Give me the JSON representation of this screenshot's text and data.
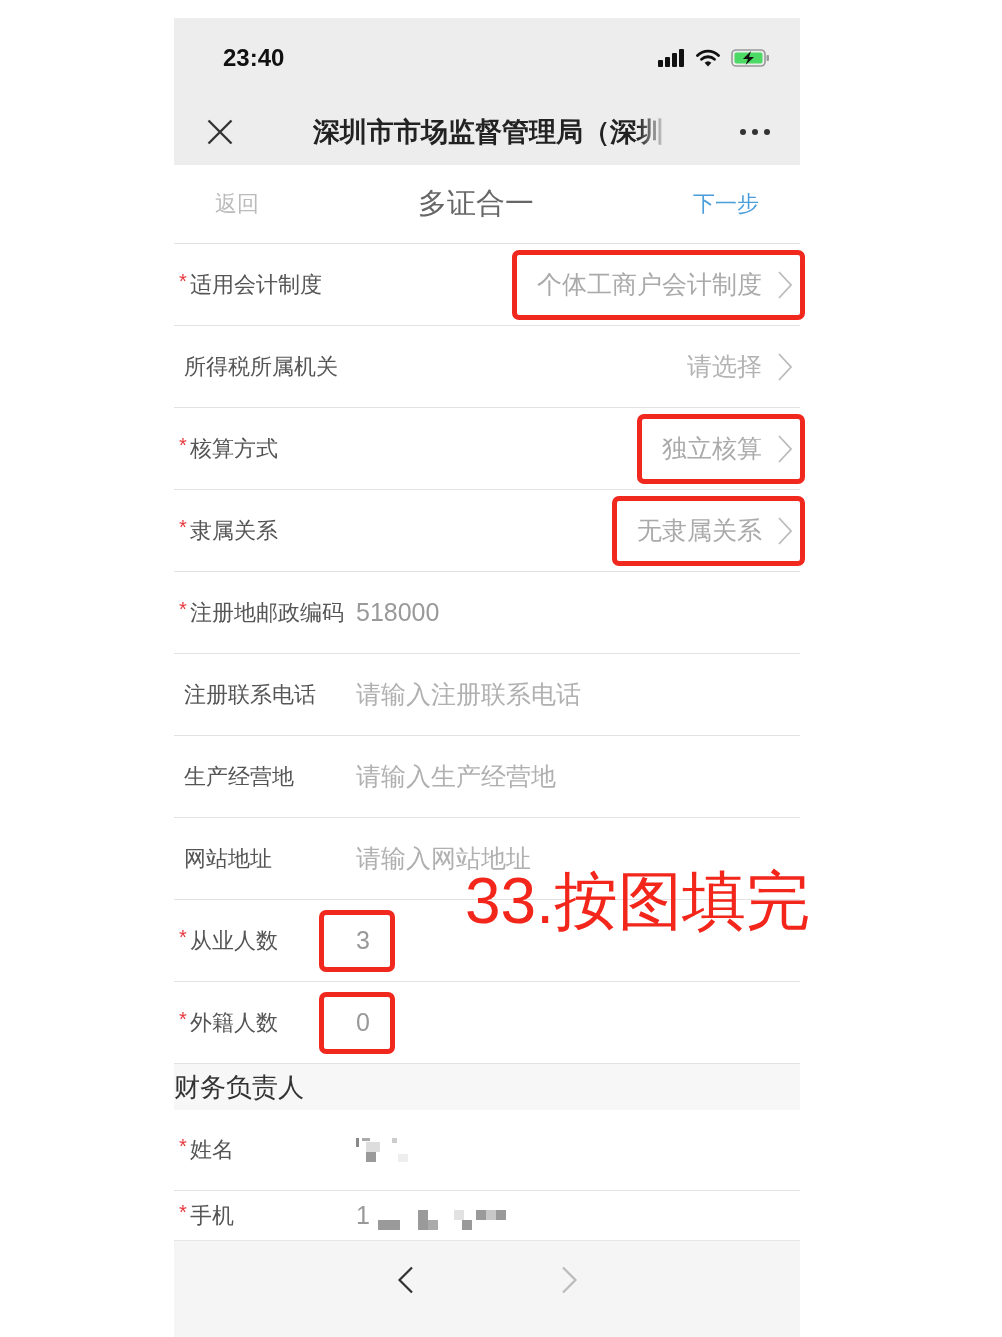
{
  "status_bar": {
    "time": "23:40"
  },
  "nav_bar": {
    "title": "深圳市市场监督管理局（深圳"
  },
  "header": {
    "back": "返回",
    "title": "多证合一",
    "next": "下一步"
  },
  "form": {
    "rows": [
      {
        "kind": "select",
        "required_mark": "*",
        "label": "适用会计制度",
        "value": "个体工商户会计制度",
        "highlighted": true
      },
      {
        "kind": "select",
        "label": "所得税所属机关",
        "placeholder": "请选择",
        "highlighted": false
      },
      {
        "kind": "select",
        "required_mark": "*",
        "label": "核算方式",
        "value": "独立核算",
        "highlighted": true
      },
      {
        "kind": "select",
        "required_mark": "*",
        "label": "隶属关系",
        "value": "无隶属关系",
        "highlighted": true
      },
      {
        "kind": "input",
        "required_mark": "*",
        "label": "注册地邮政编码",
        "value": "518000",
        "highlighted": false
      },
      {
        "kind": "input",
        "label": "注册联系电话",
        "placeholder": "请输入注册联系电话",
        "highlighted": false
      },
      {
        "kind": "input",
        "label": "生产经营地",
        "placeholder": "请输入生产经营地",
        "highlighted": false
      },
      {
        "kind": "input",
        "label": "网站地址",
        "placeholder": "请输入网站地址",
        "highlighted": false
      },
      {
        "kind": "input",
        "required_mark": "*",
        "label": "从业人数",
        "value": "3",
        "highlighted": true
      },
      {
        "kind": "input",
        "required_mark": "*",
        "label": "外籍人数",
        "value": "0",
        "highlighted": true
      }
    ]
  },
  "section": {
    "title": "财务负责人",
    "rows": [
      {
        "kind": "input",
        "required_mark": "*",
        "label": "姓名",
        "redacted": true
      },
      {
        "kind": "input",
        "required_mark": "*",
        "label": "手机",
        "value": "1",
        "redacted": true
      }
    ]
  },
  "toolbar": [
    {
      "kind": "back",
      "disabled": false
    },
    {
      "kind": "forward",
      "disabled": true
    }
  ],
  "annotation": {
    "text": "33.按图填完"
  }
}
